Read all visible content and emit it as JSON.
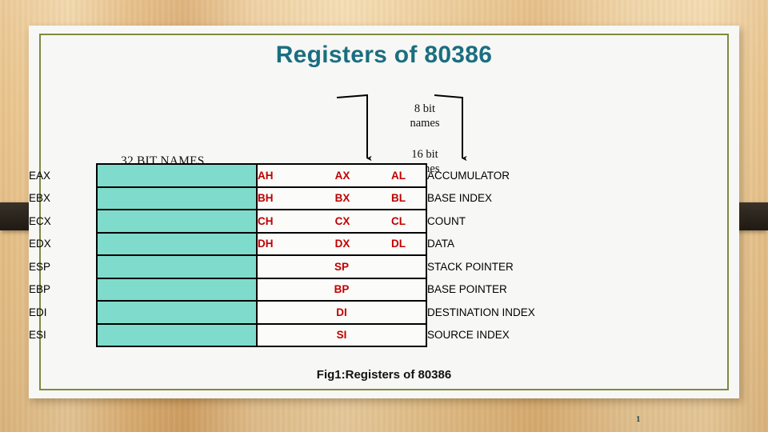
{
  "slide": {
    "title": "Registers of 80386",
    "caption": "Fig1:Registers of 80386",
    "page_number": "1",
    "accent_color": "#1a6e80",
    "frame_color": "#7d8b3e",
    "block_color": "#7fdccc",
    "register_name_color": "#c00000"
  },
  "callouts": {
    "eight_bit": "8 bit\nnames",
    "sixteen_bit": "16 bit\nnames",
    "thirty_two_bit": "32 BIT NAMES"
  },
  "table": {
    "rows": [
      {
        "name32": "EAX",
        "high": "AH",
        "wide": "AX",
        "low": "AL",
        "desc": "ACCUMULATOR",
        "merged": false
      },
      {
        "name32": "EBX",
        "high": "BH",
        "wide": "BX",
        "low": "BL",
        "desc": "BASE INDEX",
        "merged": false
      },
      {
        "name32": "ECX",
        "high": "CH",
        "wide": "CX",
        "low": "CL",
        "desc": "COUNT",
        "merged": false
      },
      {
        "name32": "EDX",
        "high": "DH",
        "wide": "DX",
        "low": "DL",
        "desc": "DATA",
        "merged": false
      },
      {
        "name32": "ESP",
        "high": "",
        "wide": "SP",
        "low": "",
        "desc": "STACK POINTER",
        "merged": true
      },
      {
        "name32": "EBP",
        "high": "",
        "wide": "BP",
        "low": "",
        "desc": "BASE POINTER",
        "merged": true
      },
      {
        "name32": "EDI",
        "high": "",
        "wide": "DI",
        "low": "",
        "desc": "DESTINATION INDEX",
        "merged": true
      },
      {
        "name32": "ESI",
        "high": "",
        "wide": "SI",
        "low": "",
        "desc": "SOURCE INDEX",
        "merged": true
      }
    ]
  }
}
